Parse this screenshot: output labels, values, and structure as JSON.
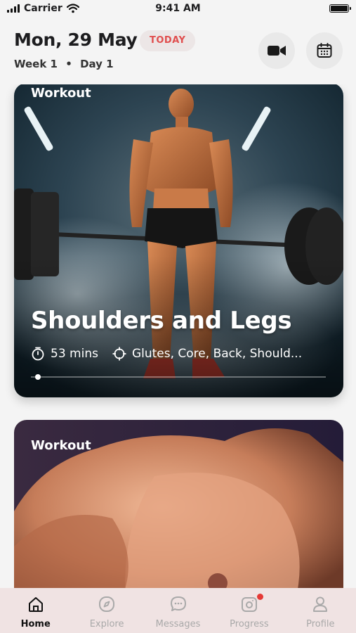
{
  "status_bar": {
    "carrier": "Carrier",
    "time": "9:41 AM"
  },
  "header": {
    "date": "Mon, 29 May",
    "today_label": "TODAY",
    "week": "Week 1",
    "separator": "•",
    "day": "Day 1",
    "video_icon": "video-camera-icon",
    "calendar_icon": "calendar-icon"
  },
  "cards": [
    {
      "tag": "Workout",
      "title": "Shoulders and Legs",
      "duration": "53 mins",
      "focus": "Glutes, Core, Back, Should...",
      "progress": 0.02
    },
    {
      "tag": "Workout"
    }
  ],
  "tabbar": {
    "items": [
      {
        "label": "Home",
        "icon": "home-icon",
        "active": true
      },
      {
        "label": "Explore",
        "icon": "compass-icon"
      },
      {
        "label": "Messages",
        "icon": "chat-icon"
      },
      {
        "label": "Progress",
        "icon": "camera-icon",
        "badge": true
      },
      {
        "label": "Profile",
        "icon": "user-icon"
      }
    ]
  },
  "colors": {
    "accent": "#e04e4e",
    "badge_red": "#e53935",
    "tabbar_bg": "#f0e3e3"
  }
}
